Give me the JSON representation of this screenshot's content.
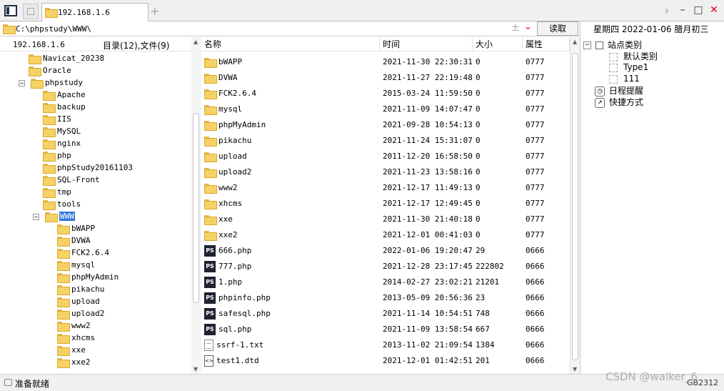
{
  "window": {
    "tab_label": "192.168.1.6",
    "add_tab": "+"
  },
  "address": {
    "path": "C:\\phpstudy\\WWW\\",
    "read_label": "读取"
  },
  "left": {
    "host": "192.168.1.6",
    "counts": "目录(12),文件(9)",
    "tree": [
      {
        "label": "Navicat_20238",
        "level": 1,
        "expander": ""
      },
      {
        "label": "Oracle",
        "level": 1,
        "expander": ""
      },
      {
        "label": "phpstudy",
        "level": 1,
        "expander": "−"
      },
      {
        "label": "Apache",
        "level": 2,
        "expander": ""
      },
      {
        "label": "backup",
        "level": 2,
        "expander": ""
      },
      {
        "label": "IIS",
        "level": 2,
        "expander": ""
      },
      {
        "label": "MySQL",
        "level": 2,
        "expander": ""
      },
      {
        "label": "nginx",
        "level": 2,
        "expander": ""
      },
      {
        "label": "php",
        "level": 2,
        "expander": ""
      },
      {
        "label": "phpStudy20161103",
        "level": 2,
        "expander": ""
      },
      {
        "label": "SQL-Front",
        "level": 2,
        "expander": ""
      },
      {
        "label": "tmp",
        "level": 2,
        "expander": ""
      },
      {
        "label": "tools",
        "level": 2,
        "expander": ""
      },
      {
        "label": "WWW",
        "level": 2,
        "expander": "−",
        "selected": true
      },
      {
        "label": "bWAPP",
        "level": 3,
        "expander": ""
      },
      {
        "label": "DVWA",
        "level": 3,
        "expander": ""
      },
      {
        "label": "FCK2.6.4",
        "level": 3,
        "expander": ""
      },
      {
        "label": "mysql",
        "level": 3,
        "expander": ""
      },
      {
        "label": "phpMyAdmin",
        "level": 3,
        "expander": ""
      },
      {
        "label": "pikachu",
        "level": 3,
        "expander": ""
      },
      {
        "label": "upload",
        "level": 3,
        "expander": ""
      },
      {
        "label": "upload2",
        "level": 3,
        "expander": ""
      },
      {
        "label": "www2",
        "level": 3,
        "expander": ""
      },
      {
        "label": "xhcms",
        "level": 3,
        "expander": ""
      },
      {
        "label": "xxe",
        "level": 3,
        "expander": ""
      },
      {
        "label": "xxe2",
        "level": 3,
        "expander": ""
      }
    ]
  },
  "files": {
    "headers": {
      "name": "名称",
      "time": "时间",
      "size": "大小",
      "attr": "属性"
    },
    "rows": [
      {
        "name": "bWAPP",
        "time": "2021-11-30 22:30:31",
        "size": "0",
        "attr": "0777",
        "type": "folder"
      },
      {
        "name": "DVWA",
        "time": "2021-11-27 22:19:48",
        "size": "0",
        "attr": "0777",
        "type": "folder"
      },
      {
        "name": "FCK2.6.4",
        "time": "2015-03-24 11:59:50",
        "size": "0",
        "attr": "0777",
        "type": "folder"
      },
      {
        "name": "mysql",
        "time": "2021-11-09 14:07:47",
        "size": "0",
        "attr": "0777",
        "type": "folder"
      },
      {
        "name": "phpMyAdmin",
        "time": "2021-09-28 10:54:13",
        "size": "0",
        "attr": "0777",
        "type": "folder"
      },
      {
        "name": "pikachu",
        "time": "2021-11-24 15:31:07",
        "size": "0",
        "attr": "0777",
        "type": "folder"
      },
      {
        "name": "upload",
        "time": "2011-12-20 16:58:50",
        "size": "0",
        "attr": "0777",
        "type": "folder"
      },
      {
        "name": "upload2",
        "time": "2021-11-23 13:58:16",
        "size": "0",
        "attr": "0777",
        "type": "folder"
      },
      {
        "name": "www2",
        "time": "2021-12-17 11:49:13",
        "size": "0",
        "attr": "0777",
        "type": "folder"
      },
      {
        "name": "xhcms",
        "time": "2021-12-17 12:49:45",
        "size": "0",
        "attr": "0777",
        "type": "folder"
      },
      {
        "name": "xxe",
        "time": "2021-11-30 21:40:18",
        "size": "0",
        "attr": "0777",
        "type": "folder"
      },
      {
        "name": "xxe2",
        "time": "2021-12-01 00:41:03",
        "size": "0",
        "attr": "0777",
        "type": "folder"
      },
      {
        "name": "666.php",
        "time": "2022-01-06 19:20:47",
        "size": "29",
        "attr": "0666",
        "type": "php"
      },
      {
        "name": "777.php",
        "time": "2021-12-28 23:17:45",
        "size": "222802",
        "attr": "0666",
        "type": "php"
      },
      {
        "name": "1.php",
        "time": "2014-02-27 23:02:21",
        "size": "21201",
        "attr": "0666",
        "type": "php"
      },
      {
        "name": "phpinfo.php",
        "time": "2013-05-09 20:56:36",
        "size": "23",
        "attr": "0666",
        "type": "php"
      },
      {
        "name": "safesql.php",
        "time": "2021-11-14 10:54:51",
        "size": "748",
        "attr": "0666",
        "type": "php"
      },
      {
        "name": "sql.php",
        "time": "2021-11-09 13:58:54",
        "size": "667",
        "attr": "0666",
        "type": "php"
      },
      {
        "name": "ssrf-1.txt",
        "time": "2013-11-02 21:09:54",
        "size": "1384",
        "attr": "0666",
        "type": "txt"
      },
      {
        "name": "test1.dtd",
        "time": "2021-12-01 01:42:51",
        "size": "201",
        "attr": "0666",
        "type": "dtd"
      }
    ]
  },
  "right": {
    "date_line": "星期四  2022-01-06  腊月初三",
    "site_category": "站点类别",
    "categories": [
      "默认类别",
      "Type1",
      "111"
    ],
    "schedule": "日程提醒",
    "shortcuts": "快捷方式"
  },
  "status": {
    "text": "准备就绪",
    "code": "GB2312",
    "watermark": "CSDN @walker_6"
  },
  "colors": {
    "folder": "#f6d266",
    "selection": "#3377d6",
    "close": "#d0021b"
  }
}
